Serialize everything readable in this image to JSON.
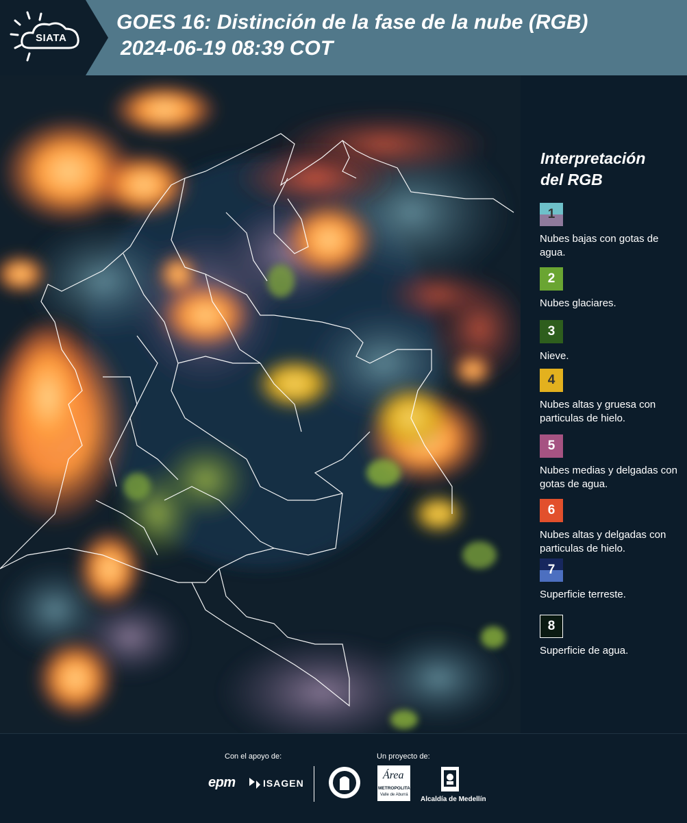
{
  "header": {
    "logo_text": "SIATA",
    "title_line1": "GOES 16: Distinción de la fase de la nube (RGB)",
    "title_line2": "2024-06-19 08:39 COT"
  },
  "legend": {
    "title_line1": "Interpretación",
    "title_line2": "del RGB",
    "items": [
      {
        "number": "1",
        "label": "Nubes bajas con gotas de agua.",
        "color_top": "#6ec0c9",
        "color_bottom": "#8f7a9c",
        "text_color": "#333333"
      },
      {
        "number": "2",
        "label": "Nubes glaciares.",
        "color_top": "#6aa532",
        "color_bottom": "#6aa532",
        "text_color": "#ffffff"
      },
      {
        "number": "3",
        "label": "Nieve.",
        "color_top": "#2e5e1d",
        "color_bottom": "#2e5e1d",
        "text_color": "#ffffff"
      },
      {
        "number": "4",
        "label": "Nubes altas y gruesa con particulas de hielo.",
        "color_top": "#e3b11e",
        "color_bottom": "#e3b11e",
        "text_color": "#333333"
      },
      {
        "number": "5",
        "label": "Nubes medias y delgadas con gotas de agua.",
        "color_top": "#a65382",
        "color_bottom": "#a65382",
        "text_color": "#ffffff"
      },
      {
        "number": "6",
        "label": "Nubes altas y delgadas con particulas de hielo.",
        "color_top": "#e2502c",
        "color_bottom": "#e2502c",
        "text_color": "#ffffff"
      },
      {
        "number": "7",
        "label": "Superficie terreste.",
        "color_top": "#17275e",
        "color_bottom": "#4c6fc0",
        "text_color": "#ffffff"
      },
      {
        "number": "8",
        "label": "Superficie de agua.",
        "color_top": "#0b1a12",
        "color_bottom": "#0b1a12",
        "text_color": "#ffffff"
      }
    ]
  },
  "footer": {
    "support_label": "Con el apoyo de:",
    "project_label": "Un proyecto de:",
    "sponsor_epm": "epm",
    "sponsor_isagen": "ISAGEN",
    "area_logo_text": "Área",
    "area_caption": "METROPOLITANA",
    "area_subcaption": "Valle de Aburrá",
    "alcaldia": "Alcaldía de Medellín"
  }
}
